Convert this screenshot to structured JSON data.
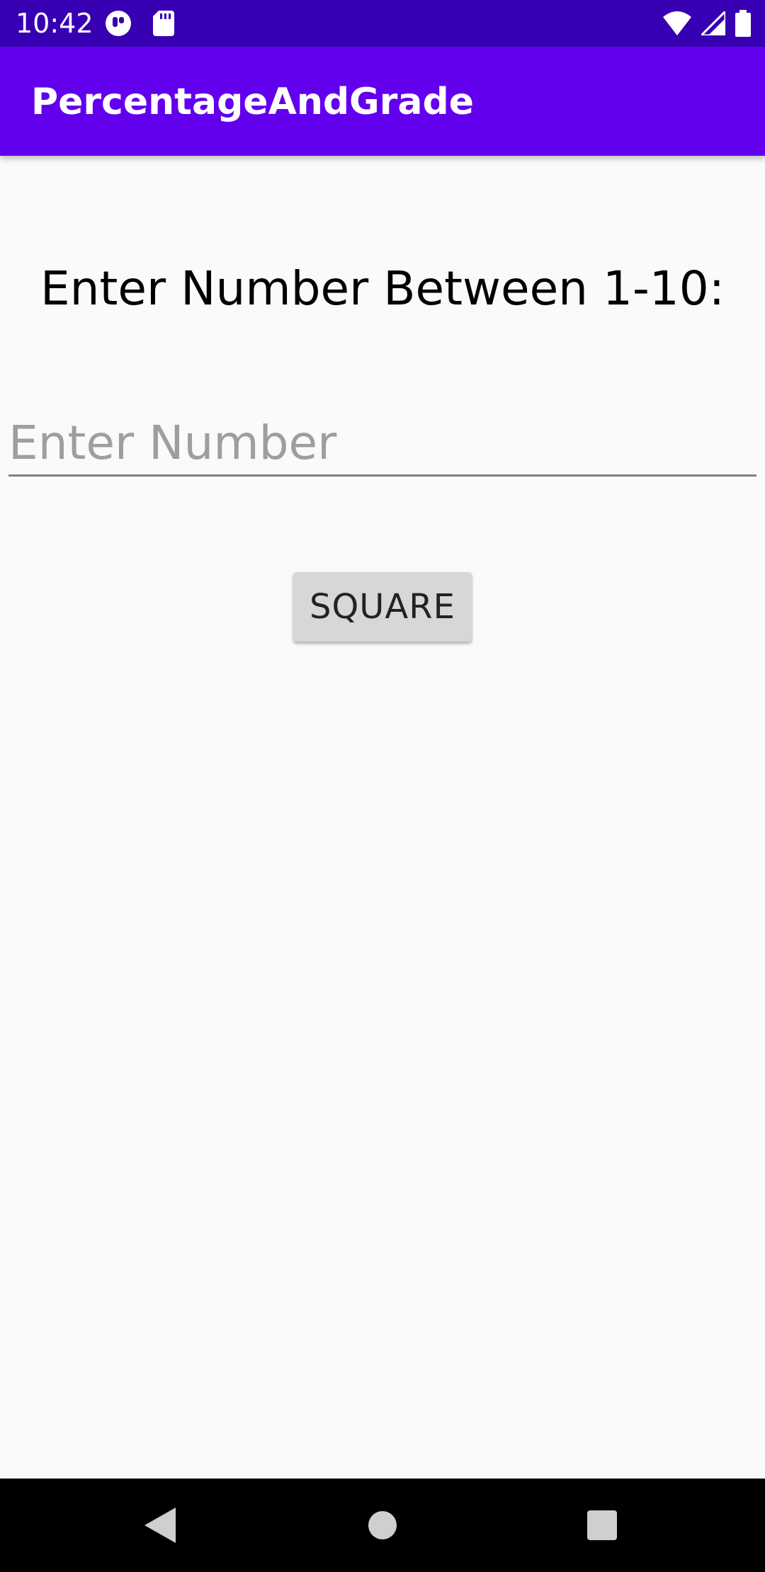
{
  "status_bar": {
    "time": "10:42",
    "left_icons": [
      "notification-app-icon",
      "sd-card-icon"
    ],
    "right_icons": [
      "wifi-icon",
      "cell-signal-icon",
      "battery-icon"
    ]
  },
  "app_bar": {
    "title": "PercentageAndGrade"
  },
  "main": {
    "prompt_label": "Enter Number Between 1-10:",
    "number_input": {
      "value": "",
      "placeholder": "Enter Number"
    },
    "square_button_label": "SQUARE"
  },
  "nav_bar": {
    "buttons": [
      "back-icon",
      "home-icon",
      "recents-icon"
    ]
  },
  "colors": {
    "status_bar": "#3700b3",
    "app_bar": "#6200ee",
    "background": "#fafafa",
    "button": "#d6d7d7"
  }
}
